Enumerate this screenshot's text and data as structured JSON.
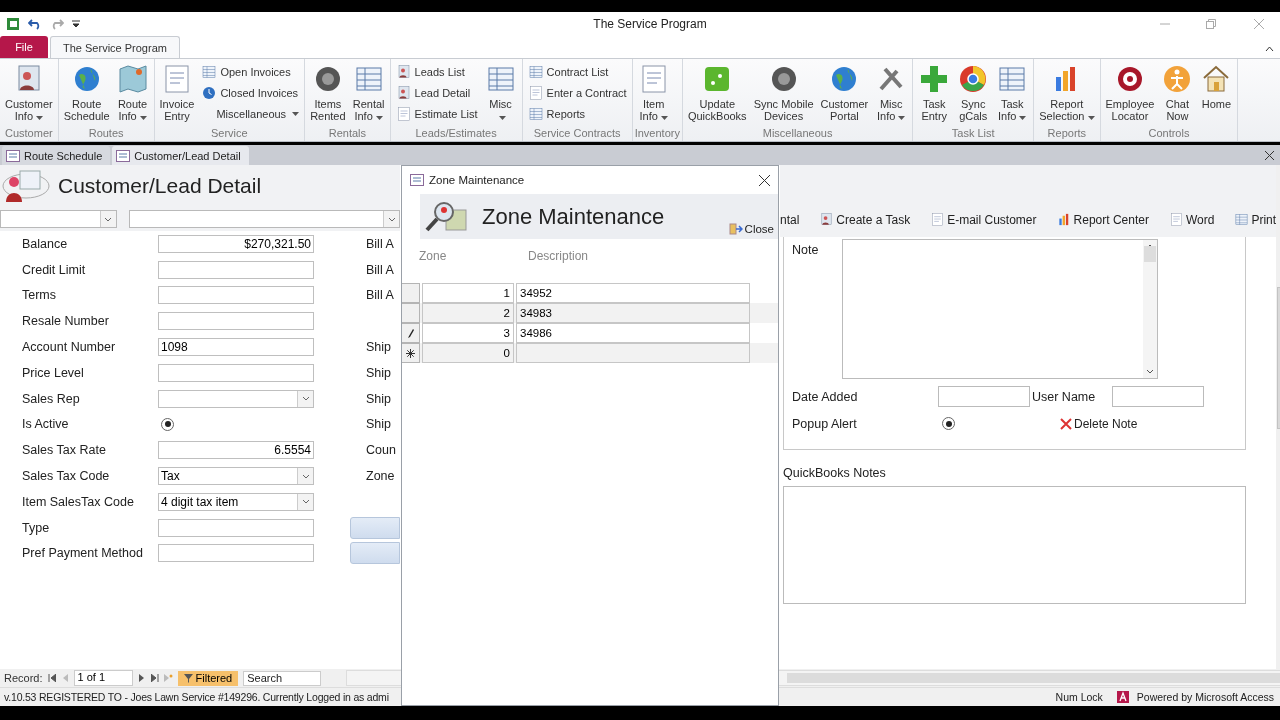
{
  "window": {
    "title": "The Service Program"
  },
  "ribbon_tabs": [
    {
      "label": "File",
      "kind": "file",
      "selected": false
    },
    {
      "label": "The Service Program",
      "kind": "tab",
      "selected": true
    }
  ],
  "ribbon_groups": [
    {
      "label": "Customer",
      "items": [
        {
          "kind": "large",
          "lines": [
            "Customer",
            "Info"
          ],
          "dropdown": true
        }
      ]
    },
    {
      "label": "Routes",
      "items": [
        {
          "kind": "large",
          "lines": [
            "Route",
            "Schedule"
          ],
          "dropdown": false
        },
        {
          "kind": "large",
          "lines": [
            "Route",
            "Info"
          ],
          "dropdown": true
        }
      ]
    },
    {
      "label": "Service",
      "items": [
        {
          "kind": "large",
          "lines": [
            "Invoice",
            "Entry"
          ],
          "dropdown": false
        },
        {
          "kind": "small",
          "lines": [
            "Open Invoices"
          ],
          "dropdown": false
        },
        {
          "kind": "small",
          "lines": [
            "Closed Invoices"
          ],
          "dropdown": false
        },
        {
          "kind": "menu",
          "lines": [
            "Miscellaneous"
          ],
          "dropdown": true
        }
      ]
    },
    {
      "label": "Rentals",
      "items": [
        {
          "kind": "large",
          "lines": [
            "Items",
            "Rented"
          ],
          "dropdown": false
        },
        {
          "kind": "large",
          "lines": [
            "Rental",
            "Info"
          ],
          "dropdown": true
        }
      ]
    },
    {
      "label": "Leads/Estimates",
      "items": [
        {
          "kind": "small",
          "lines": [
            "Leads List"
          ],
          "dropdown": false
        },
        {
          "kind": "small",
          "lines": [
            "Lead Detail"
          ],
          "dropdown": false
        },
        {
          "kind": "small",
          "lines": [
            "Estimate List"
          ],
          "dropdown": false
        },
        {
          "kind": "large",
          "lines": [
            "Misc"
          ],
          "dropdown": true
        }
      ]
    },
    {
      "label": "Service Contracts",
      "items": [
        {
          "kind": "small",
          "lines": [
            "Contract List"
          ],
          "dropdown": false
        },
        {
          "kind": "small",
          "lines": [
            "Enter a Contract"
          ],
          "dropdown": false
        },
        {
          "kind": "small",
          "lines": [
            "Reports"
          ],
          "dropdown": false
        }
      ]
    },
    {
      "label": "Inventory",
      "items": [
        {
          "kind": "large",
          "lines": [
            "Item",
            "Info"
          ],
          "dropdown": true
        }
      ]
    },
    {
      "label": "Miscellaneous",
      "items": [
        {
          "kind": "large",
          "lines": [
            "Update",
            "QuickBooks"
          ],
          "dropdown": false
        },
        {
          "kind": "large",
          "lines": [
            "Sync Mobile",
            "Devices"
          ],
          "dropdown": false
        },
        {
          "kind": "large",
          "lines": [
            "Customer",
            "Portal"
          ],
          "dropdown": false
        },
        {
          "kind": "large",
          "lines": [
            "Misc",
            "Info"
          ],
          "dropdown": true
        }
      ]
    },
    {
      "label": "Task List",
      "items": [
        {
          "kind": "large",
          "lines": [
            "Task",
            "Entry"
          ],
          "dropdown": false
        },
        {
          "kind": "large",
          "lines": [
            "Sync",
            "gCals"
          ],
          "dropdown": false
        },
        {
          "kind": "large",
          "lines": [
            "Task",
            "Info"
          ],
          "dropdown": true
        }
      ]
    },
    {
      "label": "Reports",
      "items": [
        {
          "kind": "large",
          "lines": [
            "Report",
            "Selection"
          ],
          "dropdown": true
        }
      ]
    },
    {
      "label": "Controls",
      "items": [
        {
          "kind": "large",
          "lines": [
            "Employee",
            "Locator"
          ],
          "dropdown": false
        },
        {
          "kind": "large",
          "lines": [
            "Chat",
            "Now"
          ],
          "dropdown": false
        },
        {
          "kind": "large",
          "lines": [
            "Home"
          ],
          "dropdown": false
        }
      ]
    }
  ],
  "document_tabs": [
    {
      "label": "Route Schedule",
      "selected": false
    },
    {
      "label": "Customer/Lead Detail",
      "selected": true
    }
  ],
  "form": {
    "title": "Customer/Lead Detail",
    "fields": [
      {
        "label": "Balance",
        "kind": "number",
        "value": "$270,321.50",
        "column_2_label": "Bill A"
      },
      {
        "label": "Credit Limit",
        "kind": "text",
        "column_2_label": "Bill A"
      },
      {
        "label": "Terms",
        "kind": "text",
        "column_2_label": "Bill A"
      },
      {
        "label": "Resale Number",
        "kind": "text"
      },
      {
        "label": "Account Number",
        "kind": "text",
        "value": "1098",
        "column_2_label": "Ship"
      },
      {
        "label": "Price Level",
        "kind": "text",
        "column_2_label": "Ship"
      },
      {
        "label": "Sales Rep",
        "kind": "combo",
        "column_2_label": "Ship"
      },
      {
        "label": "Is Active",
        "kind": "radio",
        "checked": true,
        "column_2_label": "Ship"
      },
      {
        "label": "Sales Tax Rate",
        "kind": "number",
        "value": "6.5554",
        "column_2_label": "Coun"
      },
      {
        "label": "Sales Tax Code",
        "kind": "combo",
        "value": "Tax",
        "column_2_label": "Zone"
      },
      {
        "label": "Item SalesTax Code",
        "kind": "combo",
        "value": "4 digit tax item"
      },
      {
        "label": "Type",
        "kind": "text"
      },
      {
        "label": "Pref Payment Method",
        "kind": "text"
      }
    ]
  },
  "toolbar": [
    "ntal",
    "Create a Task",
    "E-mail Customer",
    "Report Center",
    "Word",
    "Print"
  ],
  "note": {
    "label": "Note",
    "date_label": "Date Added",
    "user_label": "User Name",
    "popup_label": "Popup Alert",
    "popup_checked": true,
    "delete_button": "Delete Note"
  },
  "quickbooks_notes": {
    "label": "QuickBooks Notes"
  },
  "record_nav": {
    "label": "Record:",
    "position": "1 of 1",
    "filter": "Filtered",
    "search_placeholder": "Search"
  },
  "status_bar": {
    "text": "v.10.53 REGISTERED TO - Joes Lawn Service #149296. Currently Logged in as admi",
    "num_lock": "Num Lock",
    "powered": "Powered by Microsoft Access"
  },
  "dialog": {
    "title": "Zone Maintenance",
    "heading": "Zone Maintenance",
    "close_button": "Close",
    "columns": [
      "Zone",
      "Description"
    ],
    "rows": [
      {
        "kind": "record",
        "zone": "1",
        "description": "34952"
      },
      {
        "kind": "record",
        "zone": "2",
        "description": "34983"
      },
      {
        "kind": "editing",
        "zone": "3",
        "description": "34986"
      },
      {
        "kind": "new",
        "zone": "0"
      }
    ]
  }
}
